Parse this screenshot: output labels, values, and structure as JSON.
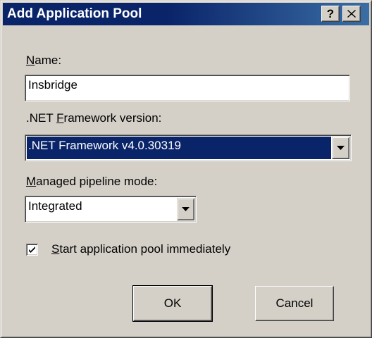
{
  "dialog": {
    "title": "Add Application Pool",
    "help_glyph": "?",
    "icons": {
      "help": "help-icon",
      "close": "close-icon"
    }
  },
  "name_field": {
    "label": "Name:",
    "mnemonic": "N",
    "label_rest": "ame:",
    "value": "Insbridge"
  },
  "framework": {
    "label": ".NET Framework version:",
    "label_prefix": ".NET ",
    "mnemonic": "F",
    "label_rest": "ramework version:",
    "selected": ".NET Framework v4.0.30319"
  },
  "pipeline": {
    "label": "Managed pipeline mode:",
    "mnemonic": "M",
    "label_rest": "anaged pipeline mode:",
    "selected": "Integrated"
  },
  "start_immediately": {
    "label": "Start application pool immediately",
    "mnemonic": "S",
    "label_rest": "tart application pool immediately",
    "checked": true
  },
  "buttons": {
    "ok": "OK",
    "cancel": "Cancel"
  },
  "colors": {
    "face": "#d4d0c8",
    "title_bar": "#0a246a",
    "selection": "#0a246a"
  }
}
